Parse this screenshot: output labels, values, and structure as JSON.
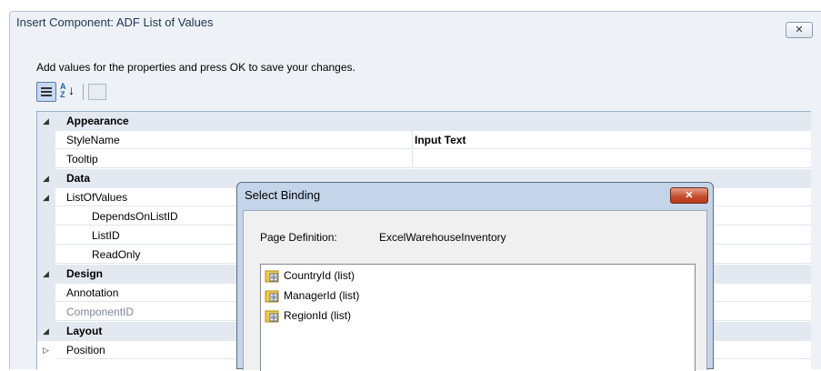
{
  "dialog": {
    "title": "Insert Component: ADF List of Values",
    "close_label": "✕",
    "instructions": "Add values for the properties and press OK to save your changes."
  },
  "toolbar": {
    "categorized_icon": "categorized-icon",
    "alphabetical_icon": "sort-alphabetical-icon",
    "alphabetical_glyph_a": "A",
    "alphabetical_glyph_z": "Z",
    "alphabetical_arrow": "↓",
    "property_pages_icon": "property-pages-icon"
  },
  "properties": {
    "appearance": {
      "label": "Appearance",
      "expander": "◢"
    },
    "style_name": {
      "label": "StyleName",
      "value": "Input Text"
    },
    "tooltip": {
      "label": "Tooltip",
      "value": ""
    },
    "data": {
      "label": "Data",
      "expander": "◢"
    },
    "list_of_values": {
      "label": "ListOfValues",
      "expander": "◢"
    },
    "depends_on_list_id": {
      "label": "DependsOnListID",
      "value": ""
    },
    "list_id": {
      "label": "ListID",
      "value": ""
    },
    "read_only": {
      "label": "ReadOnly",
      "value": ""
    },
    "design": {
      "label": "Design",
      "expander": "◢"
    },
    "annotation": {
      "label": "Annotation",
      "value": ""
    },
    "component_id": {
      "label": "ComponentID",
      "value": ""
    },
    "layout": {
      "label": "Layout",
      "expander": "◢"
    },
    "position": {
      "label": "Position",
      "expander": "▷"
    }
  },
  "select_binding": {
    "title": "Select Binding",
    "close_label": "✕",
    "page_definition_label": "Page Definition:",
    "page_definition_value": "ExcelWarehouseInventory",
    "items": [
      {
        "label": "CountryId (list)",
        "icon": "list-binding-icon"
      },
      {
        "label": "ManagerId (list)",
        "icon": "list-binding-icon"
      },
      {
        "label": "RegionId (list)",
        "icon": "list-binding-icon"
      }
    ]
  },
  "colors": {
    "dialog_bg": "#eef2f7",
    "category_bg": "#e4e9f1",
    "modal_frame": "#c4d5ea",
    "close_red": "#c34a2a"
  }
}
